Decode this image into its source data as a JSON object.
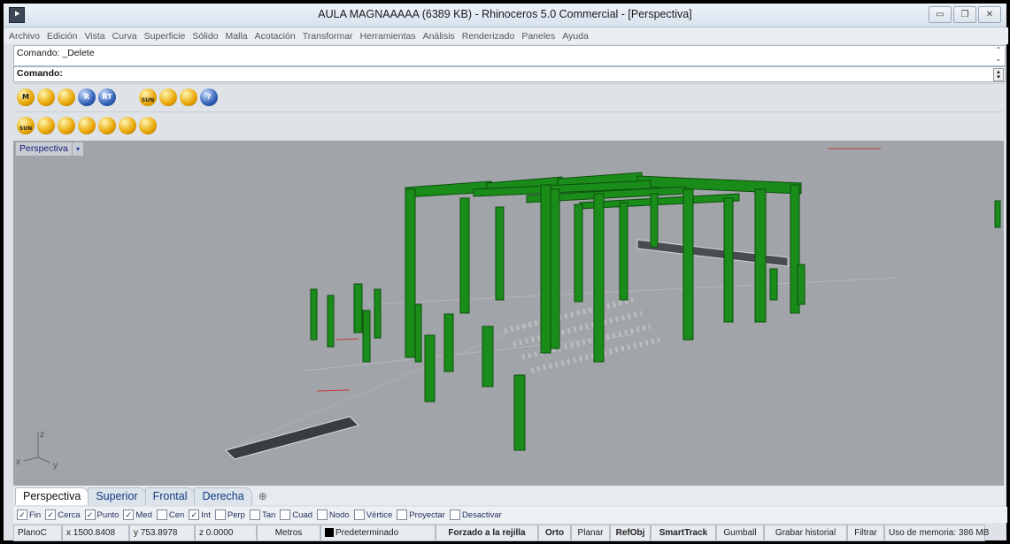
{
  "window": {
    "title": "AULA MAGNAAAAA (6389 KB) - Rhinoceros 5.0 Commercial - [Perspectiva]",
    "buttons": [
      "minimize",
      "maximize",
      "close"
    ]
  },
  "menu": [
    "Archivo",
    "Edición",
    "Vista",
    "Curva",
    "Superficie",
    "Sólido",
    "Malla",
    "Acotación",
    "Transformar",
    "Herramientas",
    "Análisis",
    "Renderizado",
    "Paneles",
    "Ayuda"
  ],
  "command": {
    "history": "Comando: _Delete",
    "prompt": "Comando:",
    "input_value": ""
  },
  "toolbar1": [
    {
      "icon": "m-render-icon",
      "label": "M"
    },
    {
      "icon": "material-icon",
      "label": ""
    },
    {
      "icon": "material-edit-icon",
      "label": ""
    },
    {
      "icon": "r-render-icon",
      "label": "R"
    },
    {
      "icon": "rt-render-icon",
      "label": "RT"
    },
    {
      "icon": "light-rays-icon",
      "label": ""
    },
    {
      "icon": "sun-icon",
      "label": "SUN"
    },
    {
      "icon": "environment-icon",
      "label": ""
    },
    {
      "icon": "landscape-icon",
      "label": ""
    },
    {
      "icon": "help-icon",
      "label": "?"
    }
  ],
  "toolbar2": [
    {
      "icon": "sun-light-icon",
      "label": "SUN"
    },
    {
      "icon": "spotlight-icon",
      "label": ""
    },
    {
      "icon": "point-light-icon",
      "label": ""
    },
    {
      "icon": "directional-light-icon",
      "label": ""
    },
    {
      "icon": "rectangular-light-icon",
      "label": ""
    },
    {
      "icon": "linear-light-icon",
      "label": ""
    },
    {
      "icon": "light-edit-icon",
      "label": ""
    }
  ],
  "viewport": {
    "label": "Perspectiva",
    "axes": {
      "z": "z",
      "x": "x",
      "y": "y"
    },
    "background": "#a1a4a8",
    "geometry_color": "#1a8c1a"
  },
  "tabs": [
    "Perspectiva",
    "Superior",
    "Frontal",
    "Derecha"
  ],
  "active_tab": "Perspectiva",
  "osnaps": [
    {
      "label": "Fin",
      "checked": true
    },
    {
      "label": "Cerca",
      "checked": true
    },
    {
      "label": "Punto",
      "checked": true
    },
    {
      "label": "Med",
      "checked": true
    },
    {
      "label": "Cen",
      "checked": false
    },
    {
      "label": "Int",
      "checked": true
    },
    {
      "label": "Perp",
      "checked": false
    },
    {
      "label": "Tan",
      "checked": false
    },
    {
      "label": "Cuad",
      "checked": false
    },
    {
      "label": "Nodo",
      "checked": false
    },
    {
      "label": "Vértice",
      "checked": false
    },
    {
      "label": "Proyectar",
      "checked": false
    },
    {
      "label": "Desactivar",
      "checked": false
    }
  ],
  "status": {
    "cplane": "PlanoC",
    "x": "x 1500.8408",
    "y": "y 753.8978",
    "z": "z 0.0000",
    "units": "Metros",
    "layer": "Predeterminado",
    "grid_snap": "Forzado a la rejilla",
    "ortho": "Orto",
    "planar": "Planar",
    "osnap": "RefObj",
    "smarttrack": "SmartTrack",
    "gumball": "Gumball",
    "history": "Grabar historial",
    "filter": "Filtrar",
    "memory": "Uso de memoria: 386 MB"
  }
}
